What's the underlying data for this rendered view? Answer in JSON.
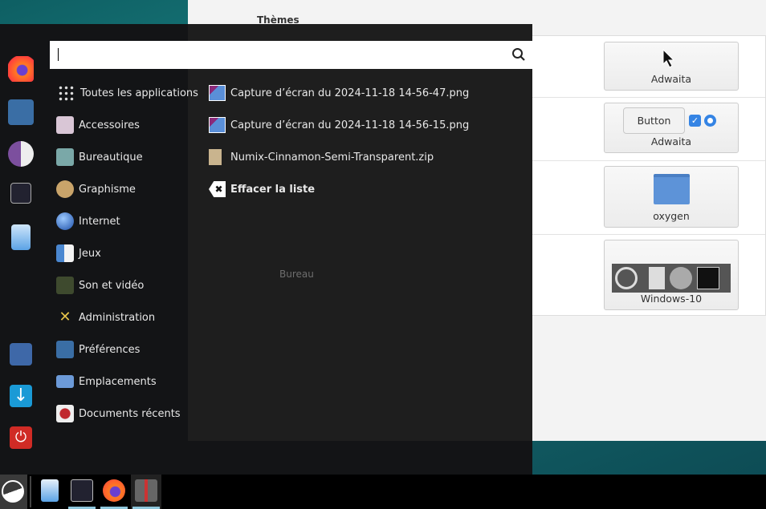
{
  "background_window": {
    "title": "Thèmes",
    "ghost_labels": [
      "Bureau"
    ],
    "themes": [
      {
        "label": "Adwaita"
      },
      {
        "label": "Adwaita",
        "preview_button": "Button"
      },
      {
        "label": "oxygen"
      },
      {
        "label": "Windows-10"
      }
    ]
  },
  "menu": {
    "search": {
      "value": "",
      "placeholder": ""
    },
    "favorites": [
      "firefox-icon",
      "preferences-icon",
      "pidgin-icon",
      "terminal-icon",
      "file-manager-icon"
    ],
    "session": [
      "lock-screen-icon",
      "logout-icon",
      "power-icon"
    ],
    "categories": [
      {
        "label": "Toutes les applications",
        "icon": "grid-icon"
      },
      {
        "label": "Accessoires",
        "icon": "accessories-icon"
      },
      {
        "label": "Bureautique",
        "icon": "office-icon"
      },
      {
        "label": "Graphisme",
        "icon": "graphics-icon"
      },
      {
        "label": "Internet",
        "icon": "internet-icon"
      },
      {
        "label": "Jeux",
        "icon": "games-icon"
      },
      {
        "label": "Son et vidéo",
        "icon": "multimedia-icon"
      },
      {
        "label": "Administration",
        "icon": "administration-icon"
      },
      {
        "label": "Préférences",
        "icon": "preferences-icon"
      },
      {
        "label": "Emplacements",
        "icon": "folder-icon"
      },
      {
        "label": "Documents récents",
        "icon": "recent-icon"
      }
    ],
    "recent": [
      {
        "label": "Capture d’écran du 2024-11-18 14-56-47.png",
        "icon": "image-file-icon"
      },
      {
        "label": "Capture d’écran du 2024-11-18 14-56-15.png",
        "icon": "image-file-icon"
      },
      {
        "label": "Numix-Cinnamon-Semi-Transparent.zip",
        "icon": "archive-icon"
      }
    ],
    "clear_label": "Effacer la liste"
  },
  "taskbar": {
    "items": [
      "menu-icon",
      "file-manager-icon",
      "terminal-icon",
      "firefox-icon",
      "user-icon"
    ]
  }
}
